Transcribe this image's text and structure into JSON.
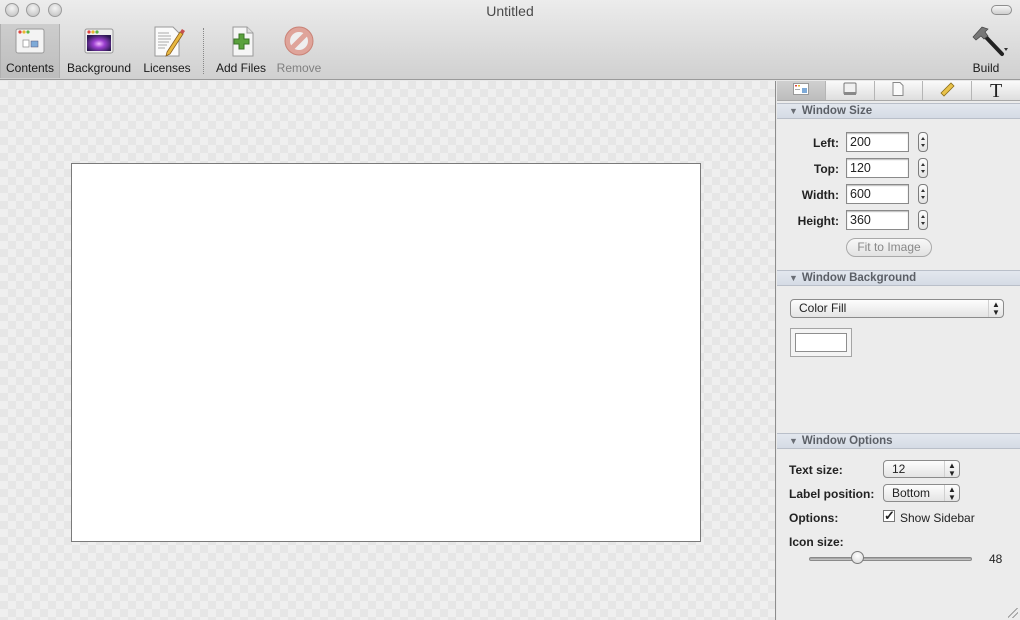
{
  "window": {
    "title": "Untitled"
  },
  "toolbar": {
    "items": [
      {
        "label": "Contents",
        "icon": "window-contents-icon",
        "selected": true
      },
      {
        "label": "Background",
        "icon": "background-image-icon"
      },
      {
        "label": "Licenses",
        "icon": "license-document-icon"
      },
      {
        "label": "Add Files",
        "icon": "add-file-icon"
      },
      {
        "label": "Remove",
        "icon": "remove-icon",
        "disabled": true
      }
    ],
    "build_label": "Build"
  },
  "inspector": {
    "tabs": [
      "layout-tab",
      "disk-tab",
      "document-tab",
      "ruler-tab",
      "text-tab"
    ],
    "window_size": {
      "header": "Window Size",
      "left_label": "Left:",
      "left": "200",
      "top_label": "Top:",
      "top": "120",
      "width_label": "Width:",
      "width": "600",
      "height_label": "Height:",
      "height": "360",
      "fit_button": "Fit to Image"
    },
    "window_background": {
      "header": "Window Background",
      "fill_type": "Color Fill",
      "color": "#ffffff"
    },
    "window_options": {
      "header": "Window Options",
      "text_size_label": "Text size:",
      "text_size": "12",
      "label_position_label": "Label position:",
      "label_position": "Bottom",
      "options_label": "Options:",
      "show_sidebar_label": "Show Sidebar",
      "show_sidebar": true,
      "icon_size_label": "Icon size:",
      "icon_size": "48"
    }
  }
}
